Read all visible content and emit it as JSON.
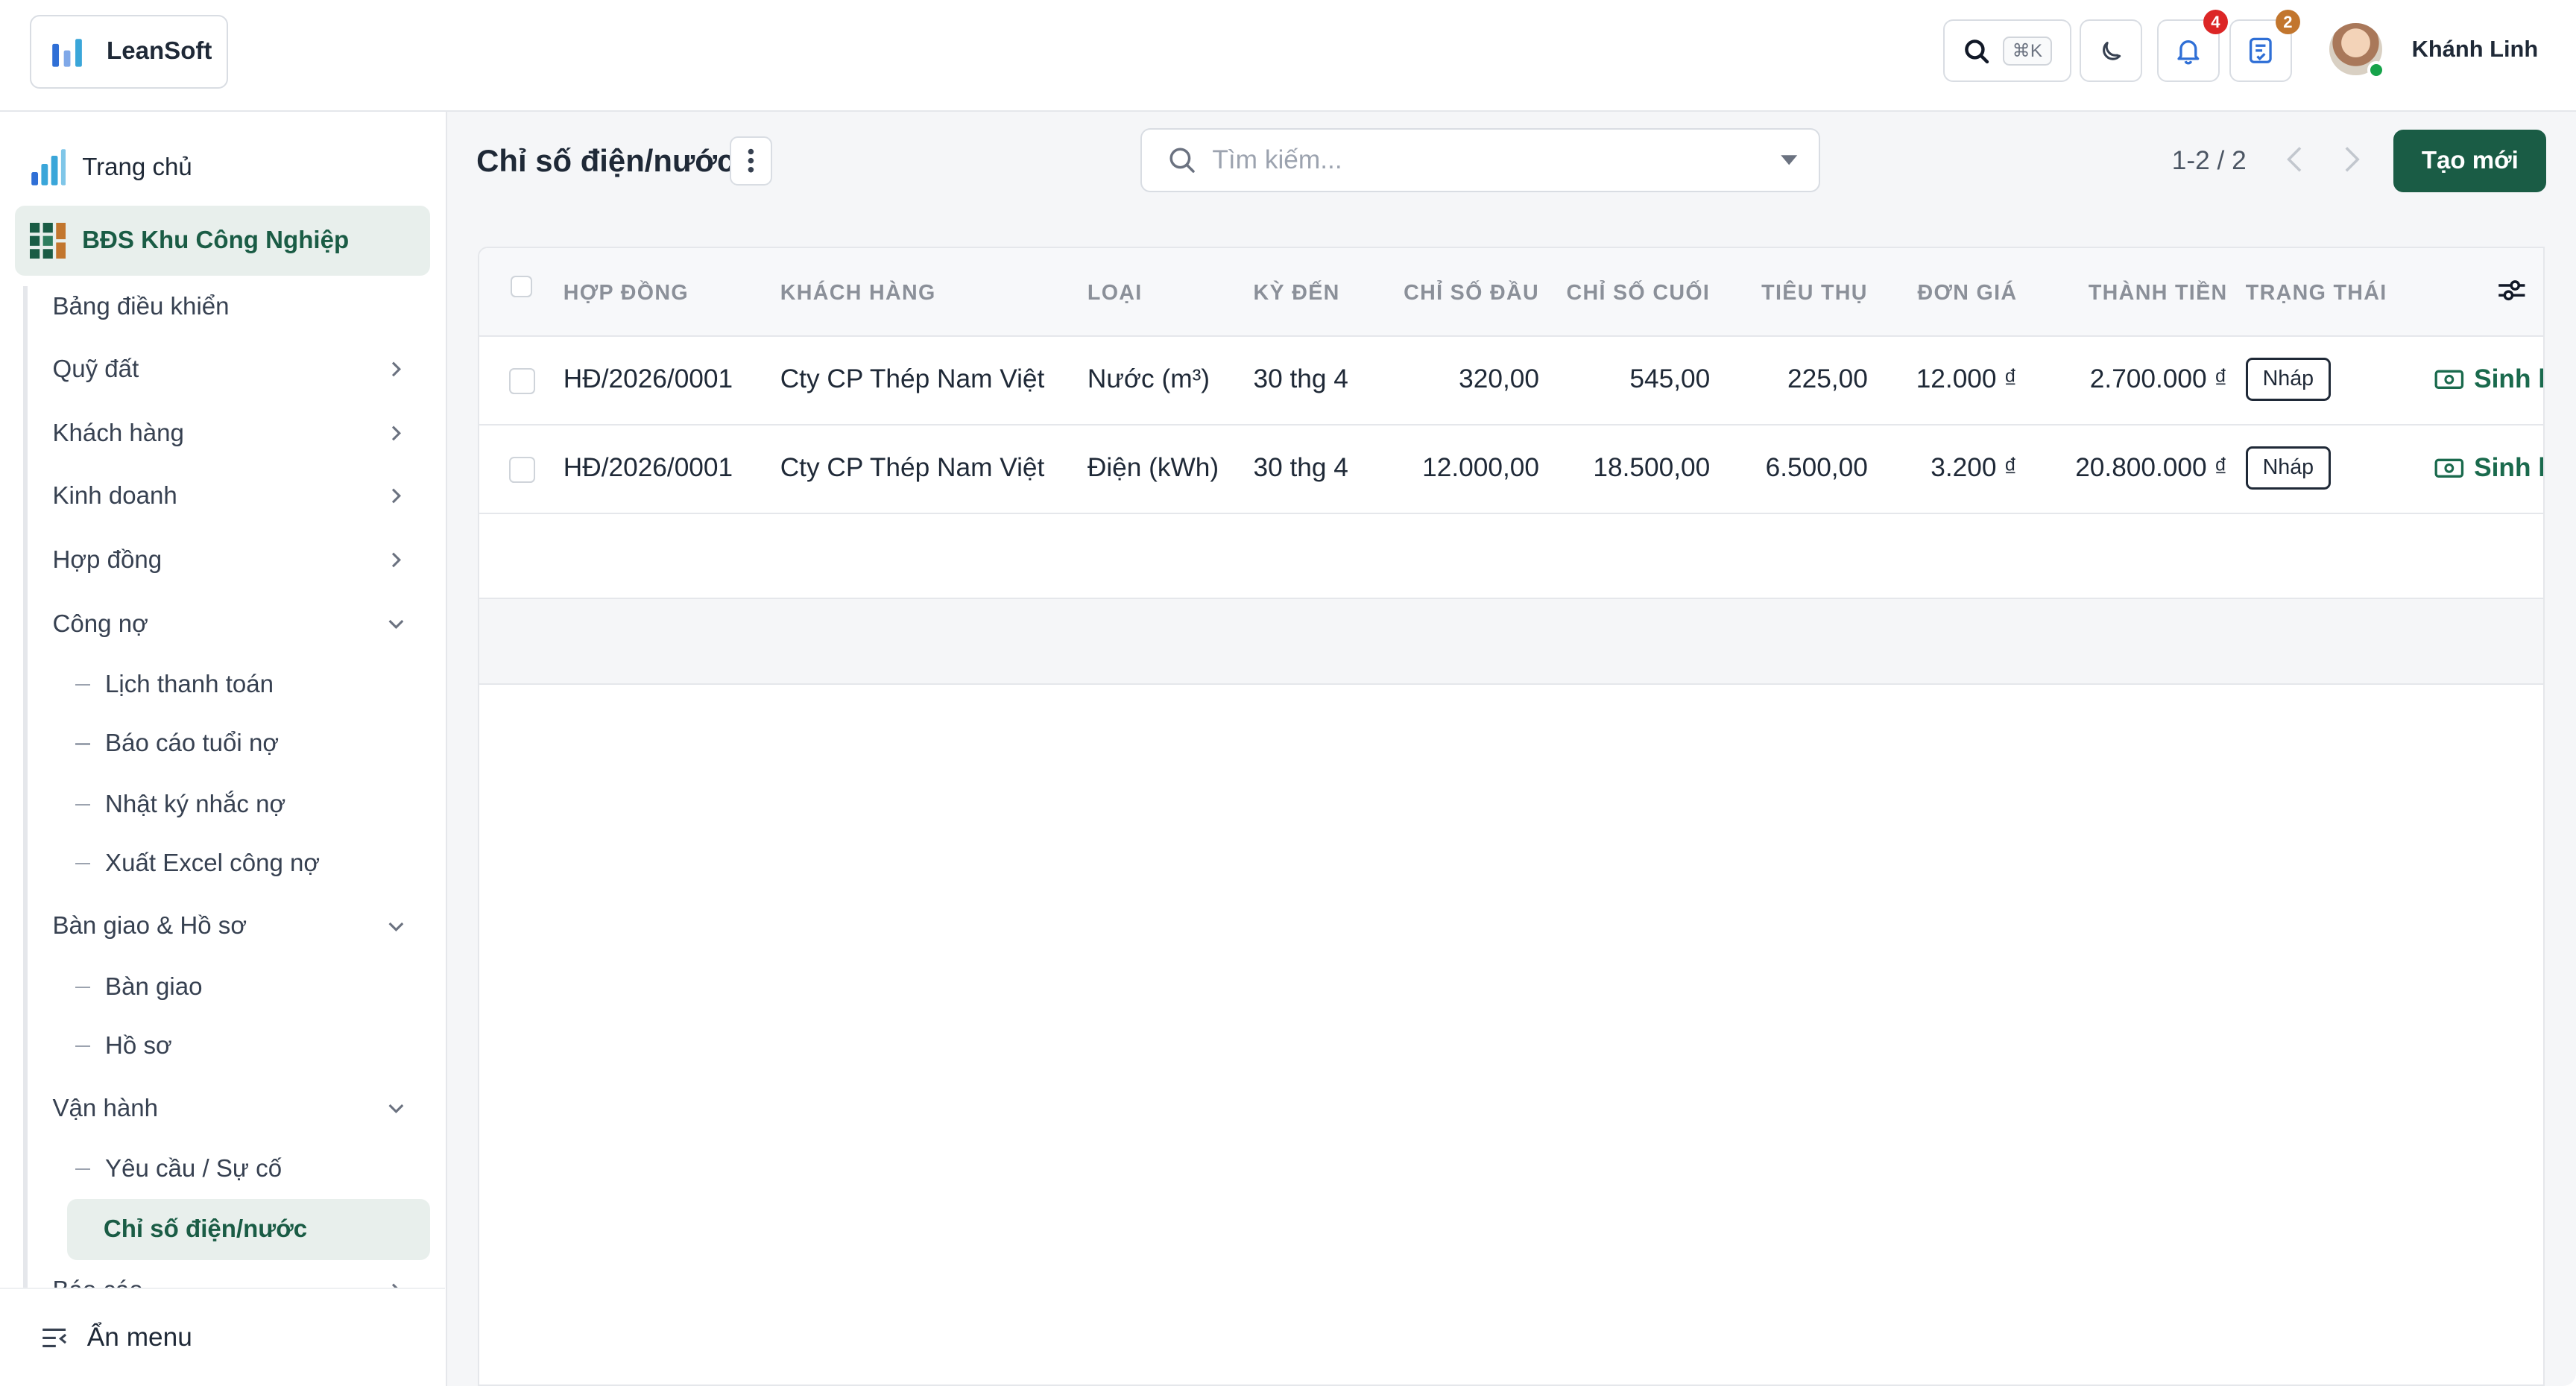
{
  "app": {
    "name": "LeanSoft"
  },
  "header": {
    "search_shortcut": "⌘K",
    "notifications_count": "4",
    "tasks_count": "2",
    "user_name": "Khánh Linh",
    "colors": {
      "notif_badge": "#dc2626",
      "tasks_badge": "#c2762e"
    }
  },
  "sidebar": {
    "home_label": "Trang chủ",
    "module_label": "BĐS Khu Công Nghiệp",
    "items": [
      {
        "label": "Bảng điều khiển"
      },
      {
        "label": "Quỹ đất"
      },
      {
        "label": "Khách hàng"
      },
      {
        "label": "Kinh doanh"
      },
      {
        "label": "Hợp đồng"
      },
      {
        "label": "Công nợ"
      },
      {
        "label": "Bàn giao & Hồ sơ"
      },
      {
        "label": "Vận hành"
      },
      {
        "label": "Báo cáo"
      }
    ],
    "cong_no_sub": [
      {
        "label": "Lịch thanh toán"
      },
      {
        "label": "Báo cáo tuổi nợ"
      },
      {
        "label": "Nhật ký nhắc nợ"
      },
      {
        "label": "Xuất Excel công nợ"
      }
    ],
    "ban_giao_sub": [
      {
        "label": "Bàn giao"
      },
      {
        "label": "Hồ sơ"
      }
    ],
    "van_hanh_sub": [
      {
        "label": "Yêu cầu / Sự cố"
      },
      {
        "label": "Chỉ số điện/nước"
      }
    ],
    "hide_menu_label": "Ẩn menu"
  },
  "page": {
    "title": "Chỉ số điện/nước",
    "search_placeholder": "Tìm kiếm...",
    "pager": "1-2 / 2",
    "create_label": "Tạo mới"
  },
  "table": {
    "columns": [
      "HỢP ĐỒNG",
      "KHÁCH HÀNG",
      "LOẠI",
      "KỲ ĐẾN",
      "CHỈ SỐ ĐẦU",
      "CHỈ SỐ CUỐI",
      "TIÊU THỤ",
      "ĐƠN GIÁ",
      "THÀNH TIỀN",
      "TRẠNG THÁI"
    ],
    "rows": [
      {
        "contract": "HĐ/2026/0001",
        "customer": "Cty CP Thép Nam Việt",
        "type": "Nước (m³)",
        "period": "30 thg 4",
        "start": "320,00",
        "end": "545,00",
        "usage": "225,00",
        "price": "12.000 ₫",
        "total": "2.700.000 ₫",
        "status": "Nháp",
        "action": "Sinh k"
      },
      {
        "contract": "HĐ/2026/0001",
        "customer": "Cty CP Thép Nam Việt",
        "type": "Điện (kWh)",
        "period": "30 thg 4",
        "start": "12.000,00",
        "end": "18.500,00",
        "usage": "6.500,00",
        "price": "3.200 ₫",
        "total": "20.800.000 ₫",
        "status": "Nháp",
        "action": "Sinh k"
      }
    ]
  },
  "colors": {
    "primary": "#1a5c45",
    "active_bg": "#e8efec"
  }
}
